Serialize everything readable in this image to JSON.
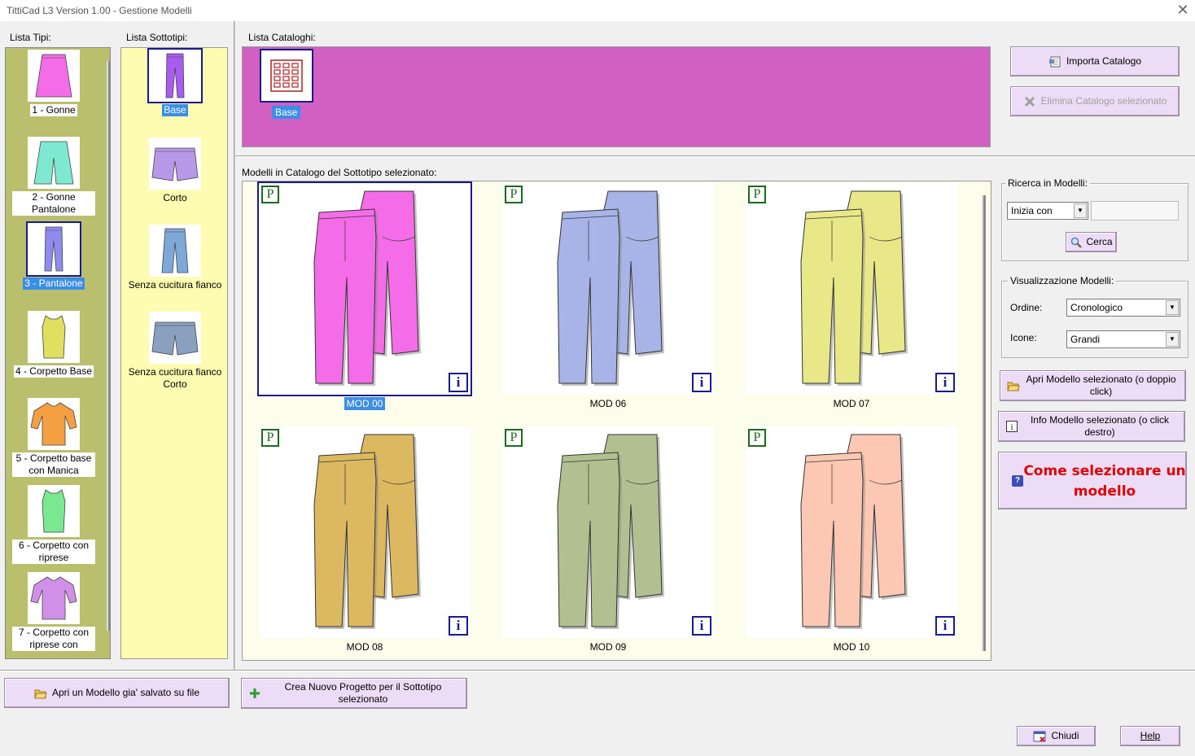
{
  "window": {
    "title": "TittiCad L3 Version 1.00 - Gestione Modelli",
    "close_glyph": "✕"
  },
  "labels": {
    "lista_tipi": "Lista Tipi:",
    "lista_sottotipi": "Lista Sottotipi:",
    "lista_cataloghi": "Lista Cataloghi:",
    "modelli_header": "Modelli in Catalogo del Sottotipo selezionato:"
  },
  "tipi": [
    {
      "label": "1 - Gonne",
      "color": "#f56ce8",
      "icon": "skirt-icon",
      "selected": false
    },
    {
      "label": "2 - Gonne Pantalone",
      "color": "#7fe8d0",
      "icon": "culottes-icon",
      "selected": false
    },
    {
      "label": "3 - Pantalone",
      "color": "#8e8cf0",
      "icon": "trousers-icon",
      "selected": true
    },
    {
      "label": "4 - Corpetto Base",
      "color": "#e0e060",
      "icon": "bodice-icon",
      "selected": false
    },
    {
      "label": "5 - Corpetto base con Manica",
      "color": "#f5a040",
      "icon": "sleeved-bodice-icon",
      "selected": false
    },
    {
      "label": "6 - Corpetto con riprese",
      "color": "#7ae890",
      "icon": "darted-bodice-icon",
      "selected": false
    },
    {
      "label": "7 - Corpetto con riprese con",
      "color": "#d090e8",
      "icon": "darted-sleeved-bodice-icon",
      "selected": false
    }
  ],
  "sottotipi": [
    {
      "label": "Base",
      "color": "#a85cf0",
      "icon": "long-trousers-icon",
      "selected": true
    },
    {
      "label": "Corto",
      "color": "#b898e8",
      "icon": "shorts-icon",
      "selected": false
    },
    {
      "label": "Senza cucitura fianco",
      "color": "#7ea8d8",
      "icon": "seamless-trousers-icon",
      "selected": false
    },
    {
      "label": "Senza cucitura fianco Corto",
      "color": "#8aa0c0",
      "icon": "seamless-shorts-icon",
      "selected": false
    }
  ],
  "cataloghi": [
    {
      "label": "Base",
      "selected": true,
      "strip_color": "#d260c2"
    }
  ],
  "modelli": [
    {
      "label": "MOD 00",
      "color": "#f56ce8",
      "selected": true,
      "p": "P",
      "i": "i"
    },
    {
      "label": "MOD 06",
      "color": "#a8b4e8",
      "selected": false,
      "p": "P",
      "i": "i"
    },
    {
      "label": "MOD 07",
      "color": "#e8e888",
      "selected": false,
      "p": "P",
      "i": "i"
    },
    {
      "label": "MOD 08",
      "color": "#dcb860",
      "selected": false,
      "p": "P",
      "i": "i"
    },
    {
      "label": "MOD 09",
      "color": "#b0c090",
      "selected": false,
      "p": "P",
      "i": "i"
    },
    {
      "label": "MOD 10",
      "color": "#fcc8b4",
      "selected": false,
      "p": "P",
      "i": "i"
    }
  ],
  "buttons": {
    "importa": "Importa Catalogo",
    "elimina": "Elimina Catalogo selezionato",
    "cerca": "Cerca",
    "apri_selezionato": "Apri Modello selezionato (o doppio click)",
    "info_selezionato": "Info Modello selezionato (o click destro)",
    "come_selezionare": "Come selezionare un modello",
    "apri_file": "Apri un Modello gia' salvato su file",
    "crea_nuovo": "Crea Nuovo Progetto per il Sottotipo selezionato",
    "chiudi": "Chiudi",
    "help": "Help"
  },
  "ricerca": {
    "title": "Ricerca in Modelli:",
    "mode": "Inizia con",
    "query": ""
  },
  "visualizzazione": {
    "title": "Visualizzazione Modelli:",
    "ordine_label": "Ordine:",
    "ordine_value": "Cronologico",
    "icone_label": "Icone:",
    "icone_value": "Grandi"
  },
  "colors": {
    "selection_blue": "#3a8ee6",
    "tipi_bg": "#b9bf6c",
    "sottotipi_bg": "#fdfcb0",
    "button_bg": "#ecdcf6",
    "alert_red": "#e00000"
  }
}
